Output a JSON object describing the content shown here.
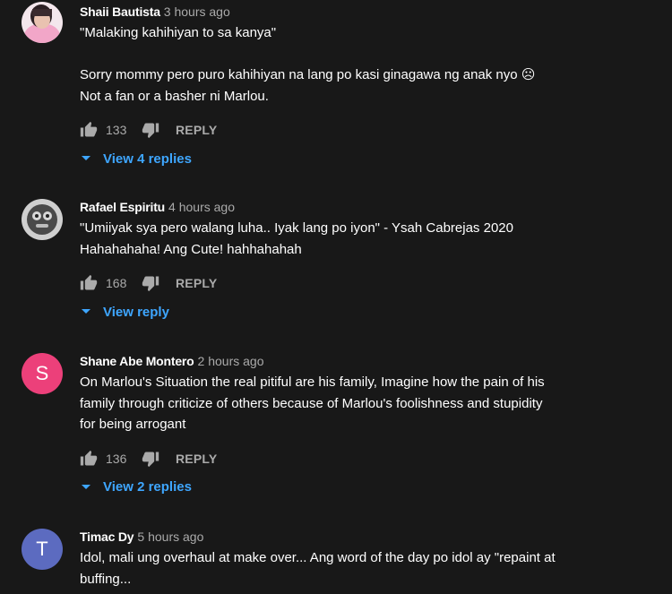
{
  "comments": [
    {
      "author": "Shaii Bautista",
      "time": "3 hours ago",
      "lines": [
        "\"Malaking kahihiyan to sa kanya\"",
        "Sorry mommy pero puro kahihiyan na lang po kasi ginagawa ng anak nyo ☹",
        "Not a fan or a basher ni Marlou."
      ],
      "likes": "133",
      "reply_label": "REPLY",
      "replies_label": "View 4 replies",
      "avatar": "photo-pink"
    },
    {
      "author": "Rafael Espiritu",
      "time": "4 hours ago",
      "lines": [
        "\"Umiiyak sya pero walang luha.. Iyak lang po iyon\" - Ysah Cabrejas 2020",
        "Hahahahaha! Ang Cute! hahhahahah"
      ],
      "likes": "168",
      "reply_label": "REPLY",
      "replies_label": "View reply",
      "avatar": "photo-grey"
    },
    {
      "author": "Shane Abe Montero",
      "time": "2 hours ago",
      "lines": [
        "On Marlou's Situation the real pitiful are his family, Imagine how the pain of his",
        "family through criticize of others because of Marlou's foolishness and stupidity",
        "for being arrogant"
      ],
      "likes": "136",
      "reply_label": "REPLY",
      "replies_label": "View 2 replies",
      "avatar_letter": "S",
      "avatar_color": "#ec407a"
    },
    {
      "author": "Timac Dy",
      "time": "5 hours ago",
      "lines": [
        "Idol, mali ung overhaul at make over... Ang word of the day po idol ay \"repaint at",
        "buffing..."
      ],
      "avatar_letter": "T",
      "avatar_color": "#5c6bc0"
    }
  ],
  "colors": {
    "background": "#181818",
    "link": "#3ea6ff",
    "secondary": "#aaaaaa"
  }
}
